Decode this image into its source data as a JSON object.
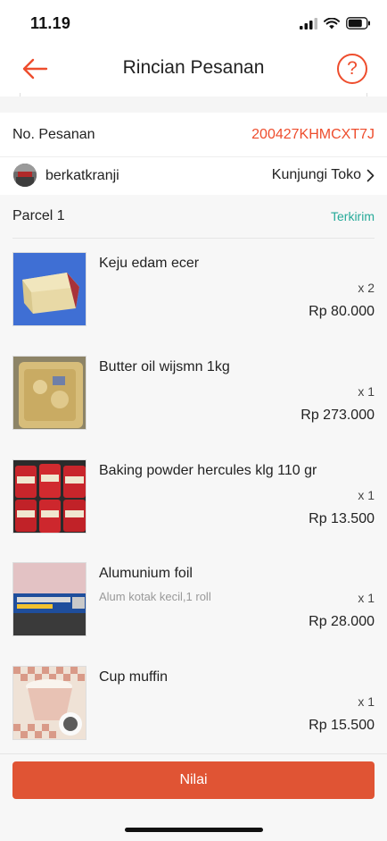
{
  "status_bar": {
    "time": "11.19"
  },
  "header": {
    "title": "Rincian Pesanan"
  },
  "order": {
    "label": "No. Pesanan",
    "number": "200427KHMCXT7J"
  },
  "shop": {
    "name": "berkatkranji",
    "visit_label": "Kunjungi Toko"
  },
  "parcel": {
    "title": "Parcel 1",
    "status": "Terkirim"
  },
  "items": [
    {
      "name": "Keju edam ecer",
      "variant": "",
      "qty": "x 2",
      "price": "Rp 80.000",
      "thumb_icon": "cheese-image"
    },
    {
      "name": "Butter oil wijsmn 1kg",
      "variant": "",
      "qty": "x 1",
      "price": "Rp 273.000",
      "thumb_icon": "butter-oil-image"
    },
    {
      "name": "Baking powder hercules klg 110 gr",
      "variant": "",
      "qty": "x 1",
      "price": "Rp 13.500",
      "thumb_icon": "baking-powder-cans-image"
    },
    {
      "name": "Alumunium foil",
      "variant": "Alum kotak kecil,1 roll",
      "qty": "x 1",
      "price": "Rp 28.000",
      "thumb_icon": "aluminium-foil-image"
    },
    {
      "name": "Cup muffin",
      "variant": "",
      "qty": "x 1",
      "price": "Rp 15.500",
      "thumb_icon": "muffin-cups-image"
    }
  ],
  "actions": {
    "rate_label": "Nilai"
  },
  "colors": {
    "brand": "#ee4d2d",
    "success": "#26aa99",
    "button": "#e05434"
  }
}
